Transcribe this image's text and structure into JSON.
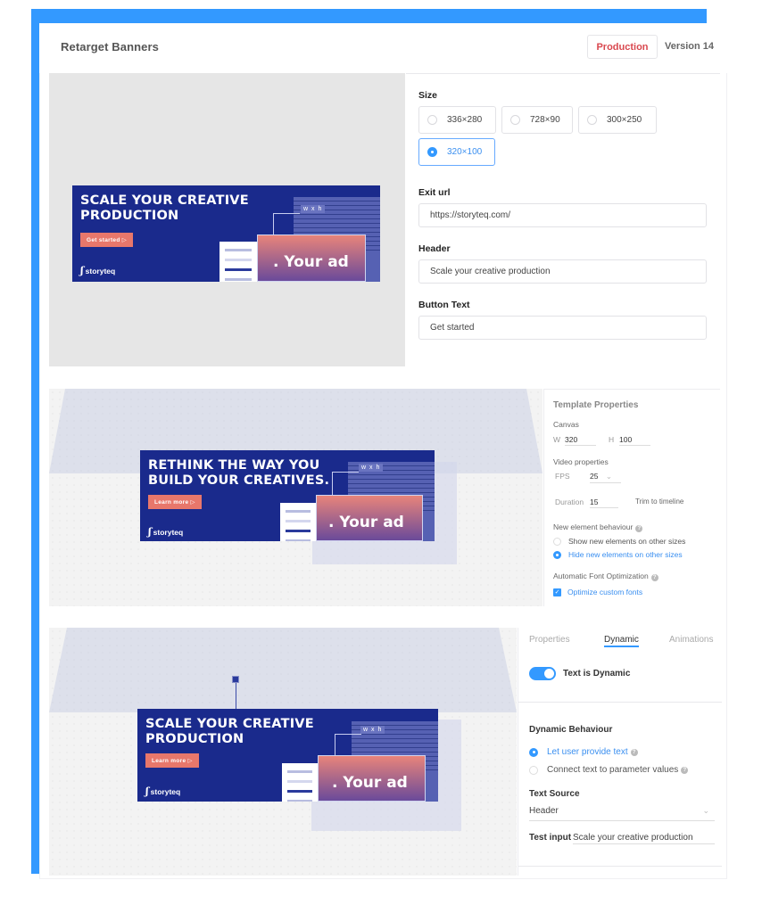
{
  "header": {
    "title": "Retarget Banners",
    "environment_button": "Production",
    "version": "Version 14"
  },
  "colors": {
    "accent": "#3399ff",
    "production": "#d9484f",
    "banner_bg": "#1a2a8c",
    "cta": "#e8776b"
  },
  "settings": {
    "size_label": "Size",
    "sizes": [
      {
        "label": "336×280",
        "selected": false
      },
      {
        "label": "728×90",
        "selected": false
      },
      {
        "label": "300×250",
        "selected": false
      },
      {
        "label": "320×100",
        "selected": true
      }
    ],
    "exit_url_label": "Exit url",
    "exit_url_value": "https://storyteq.com/",
    "header_label": "Header",
    "header_value": "Scale your creative production",
    "button_text_label": "Button Text",
    "button_text_value": "Get started"
  },
  "banners": [
    {
      "headline_1": "SCALE YOUR CREATIVE",
      "headline_2": "PRODUCTION",
      "cta": "Get started ▷",
      "logo": "storyteq",
      "logo_mark": "ʃ",
      "wxh": "w x h",
      "ad_text": ". Your ad"
    },
    {
      "headline_1": "RETHINK THE WAY YOU",
      "headline_2": "BUILD YOUR CREATIVES.",
      "cta": "Learn more ▷",
      "logo": "storyteq",
      "logo_mark": "ʃ",
      "wxh": "w x h",
      "ad_text": ". Your ad"
    },
    {
      "headline_1": "SCALE YOUR CREATIVE",
      "headline_2": "PRODUCTION",
      "cta": "Learn more ▷",
      "logo": "storyteq",
      "logo_mark": "ʃ",
      "wxh": "w x h",
      "ad_text": ". Your ad"
    }
  ],
  "template_properties": {
    "title": "Template Properties",
    "canvas_label": "Canvas",
    "width_label": "W",
    "width_value": "320",
    "height_label": "H",
    "height_value": "100",
    "video_label": "Video properties",
    "fps_label": "FPS",
    "fps_value": "25",
    "duration_label": "Duration",
    "duration_value": "15",
    "trim_label": "Trim to timeline",
    "new_element_label": "New element behaviour",
    "new_element_options": [
      {
        "label": "Show new elements on other sizes",
        "selected": false
      },
      {
        "label": "Hide new elements on other sizes",
        "selected": true
      }
    ],
    "font_opt_label": "Automatic Font Optimization",
    "font_opt_checkbox": "Optimize custom fonts",
    "font_opt_checked": true,
    "help_glyph": "?",
    "chevron": "⌄",
    "check_glyph": "✓"
  },
  "dynamic_panel": {
    "tabs": [
      {
        "label": "Properties",
        "active": false
      },
      {
        "label": "Dynamic",
        "active": true
      },
      {
        "label": "Animations",
        "active": false
      }
    ],
    "toggle_label": "Text is Dynamic",
    "toggle_on": true,
    "behaviour_title": "Dynamic Behaviour",
    "behaviour_options": [
      {
        "label": "Let user provide text",
        "selected": true
      },
      {
        "label": "Connect text to parameter values",
        "selected": false
      }
    ],
    "text_source_label": "Text Source",
    "text_source_value": "Header",
    "test_input_label": "Test input",
    "test_input_value": "Scale your creative production"
  }
}
